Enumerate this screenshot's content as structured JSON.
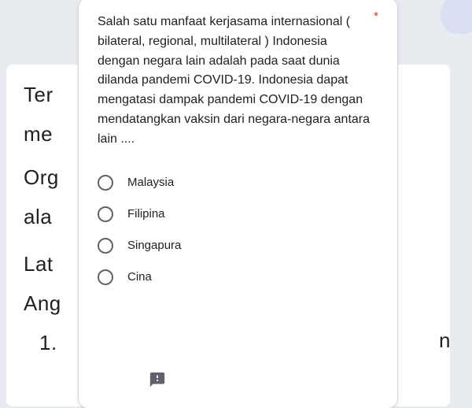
{
  "background": {
    "lines": [
      "Ter",
      "me",
      "Org",
      "ala",
      "Lat",
      "Ang",
      "1."
    ],
    "right_fragment": "n"
  },
  "question": {
    "text": "Salah satu manfaat kerjasama internasional  ( bilateral, regional, multilateral ) Indonesia dengan negara lain adalah pada saat dunia dilanda pandemi COVID-19. Indonesia dapat mengatasi dampak pandemi COVID-19 dengan mendatangkan vaksin dari negara-negara antara lain ....",
    "required_marker": "*"
  },
  "options": [
    "Malaysia",
    "Filipina",
    "Singapura",
    "Cina"
  ]
}
